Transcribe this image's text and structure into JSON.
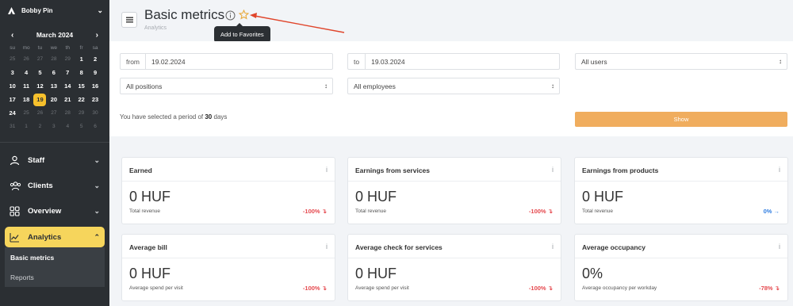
{
  "sidebar": {
    "user_name": "Bobby Pin",
    "calendar": {
      "month": "March 2024",
      "day_names": [
        "su",
        "mo",
        "tu",
        "we",
        "th",
        "fr",
        "sa"
      ],
      "weeks": [
        [
          {
            "d": "25",
            "o": true
          },
          {
            "d": "26",
            "o": true
          },
          {
            "d": "27",
            "o": true
          },
          {
            "d": "28",
            "o": true
          },
          {
            "d": "29",
            "o": true
          },
          {
            "d": "1"
          },
          {
            "d": "2"
          }
        ],
        [
          {
            "d": "3"
          },
          {
            "d": "4"
          },
          {
            "d": "5"
          },
          {
            "d": "6"
          },
          {
            "d": "7"
          },
          {
            "d": "8"
          },
          {
            "d": "9"
          }
        ],
        [
          {
            "d": "10"
          },
          {
            "d": "11"
          },
          {
            "d": "12"
          },
          {
            "d": "13"
          },
          {
            "d": "14"
          },
          {
            "d": "15"
          },
          {
            "d": "16"
          }
        ],
        [
          {
            "d": "17"
          },
          {
            "d": "18"
          },
          {
            "d": "19",
            "t": true
          },
          {
            "d": "20"
          },
          {
            "d": "21"
          },
          {
            "d": "22"
          },
          {
            "d": "23"
          }
        ],
        [
          {
            "d": "24"
          },
          {
            "d": "25",
            "o": true
          },
          {
            "d": "26",
            "o": true
          },
          {
            "d": "27",
            "o": true
          },
          {
            "d": "28",
            "o": true
          },
          {
            "d": "29",
            "o": true
          },
          {
            "d": "30",
            "o": true
          }
        ],
        [
          {
            "d": "31",
            "o": true
          },
          {
            "d": "1",
            "o": true
          },
          {
            "d": "2",
            "o": true
          },
          {
            "d": "3",
            "o": true
          },
          {
            "d": "4",
            "o": true
          },
          {
            "d": "5",
            "o": true
          },
          {
            "d": "6",
            "o": true
          }
        ]
      ]
    },
    "nav": {
      "staff": "Staff",
      "clients": "Clients",
      "overview": "Overview",
      "analytics": "Analytics",
      "basic_metrics": "Basic metrics",
      "reports": "Reports"
    }
  },
  "header": {
    "title": "Basic metrics",
    "subtitle": "Analytics",
    "tooltip": "Add to Favorites"
  },
  "filters": {
    "from_label": "from",
    "from_value": "19.02.2024",
    "to_label": "to",
    "to_value": "19.03.2024",
    "users": "All users",
    "positions": "All positions",
    "employees": "All employees",
    "period_prefix": "You have selected a period of",
    "period_days": "30",
    "period_suffix": "days",
    "show_button": "Show"
  },
  "cards": [
    {
      "title": "Earned",
      "value": "0 HUF",
      "sub": "Total revenue",
      "change": "-100%",
      "dir": "neg"
    },
    {
      "title": "Earnings from services",
      "value": "0 HUF",
      "sub": "Total revenue",
      "change": "-100%",
      "dir": "neg"
    },
    {
      "title": "Earnings from products",
      "value": "0 HUF",
      "sub": "Total revenue",
      "change": "0%",
      "dir": "pos"
    },
    {
      "title": "Average bill",
      "value": "0 HUF",
      "sub": "Average spend per visit",
      "change": "-100%",
      "dir": "neg"
    },
    {
      "title": "Average check for services",
      "value": "0 HUF",
      "sub": "Average spend per visit",
      "change": "-100%",
      "dir": "neg"
    },
    {
      "title": "Average occupancy",
      "value": "0%",
      "sub": "Average occupancy per workday",
      "change": "-78%",
      "dir": "neg"
    }
  ],
  "colors": {
    "sidebar_bg": "#2b2f33",
    "accent_yellow": "#f6d55c",
    "show_button": "#f0ad5e",
    "negative": "#e5484d",
    "positive": "#2f7de1",
    "annotation_arrow": "#e0452b"
  }
}
